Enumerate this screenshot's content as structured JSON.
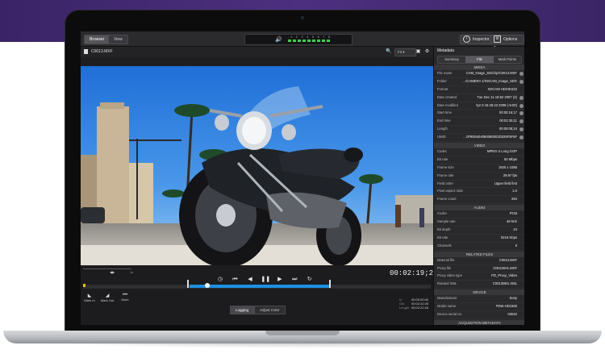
{
  "topbar": {
    "tabs": [
      "Browser",
      "View"
    ],
    "meter_scale": "-1 2 3 4 5 6 7 8",
    "inspector_label": "Inspector",
    "options_label": "Options"
  },
  "clip": {
    "name": "C0013.MXF",
    "fit_label": "Fit"
  },
  "transport": {
    "speed_a": "◀▶",
    "speed_b": "1x",
    "timecode": "00:02:19;20",
    "mark_in": "Mark In",
    "mark_out": "Mark Out",
    "more": "More",
    "tabs": [
      "Logging",
      "Adjust Color"
    ],
    "in_label": "In",
    "in_value": "00:00:00:00",
    "out_label": "Out",
    "out_value": "00:02:22:26",
    "length_label": "Length",
    "length_value": "00:02:22:26"
  },
  "metadata": {
    "title": "Metadata",
    "tabs": [
      "Summary",
      "File",
      "Mark Points"
    ],
    "sections": [
      {
        "title": "MEDIA",
        "rows": [
          {
            "k": "File name",
            "v": "CAM_Image_SD/Clip/C0013.MXF",
            "info": true
          },
          {
            "k": "Folder",
            "v": "…/CAMERA 1/XDCAM_Image_SD/Clip",
            "info": true
          },
          {
            "k": "Format",
            "v": "XDCAM HD/HD422",
            "info": false
          },
          {
            "k": "Date created",
            "v": "Tue Dec 11 16:52 2007 (2)",
            "info": true
          },
          {
            "k": "Date modified",
            "v": "Apr 9 15:46:22 2008 (-5:00)",
            "info": true
          },
          {
            "k": "Start time",
            "v": "00:00:16;17",
            "info": true
          },
          {
            "k": "End time",
            "v": "00:02:25;11",
            "info": true
          },
          {
            "k": "Length",
            "v": "00:00:08;24",
            "info": true
          },
          {
            "k": "UMID",
            "v": "…0F9D6404050080002D025F5F5F",
            "info": true
          }
        ]
      },
      {
        "title": "VIDEO",
        "rows": [
          {
            "k": "Codec",
            "v": "MPEG-2 Long GOP",
            "info": false
          },
          {
            "k": "Bit rate",
            "v": "50 Mbps",
            "info": false
          },
          {
            "k": "Frame size",
            "v": "1920 x 1080",
            "info": false
          },
          {
            "k": "Frame rate",
            "v": "29.97 fps",
            "info": false
          },
          {
            "k": "Field order",
            "v": "Upper field first",
            "info": false
          },
          {
            "k": "Pixel aspect ratio",
            "v": "1.0",
            "info": false
          },
          {
            "k": "Frame count",
            "v": "264",
            "info": false
          }
        ]
      },
      {
        "title": "AUDIO",
        "rows": [
          {
            "k": "Codec",
            "v": "PCM",
            "info": false
          },
          {
            "k": "Sample rate",
            "v": "48 kHz",
            "info": false
          },
          {
            "k": "Bit depth",
            "v": "24",
            "info": false
          },
          {
            "k": "Bit rate",
            "v": "9216 Kbps",
            "info": false
          },
          {
            "k": "Channels",
            "v": "8",
            "info": false
          }
        ]
      },
      {
        "title": "RELATED FILES",
        "rows": [
          {
            "k": "Material file",
            "v": "C0013.MXF",
            "info": false
          },
          {
            "k": "Proxy file",
            "v": "C0013S01.MXF",
            "info": false
          },
          {
            "k": "Proxy video type",
            "v": "PD_Proxy_Video",
            "info": false
          },
          {
            "k": "Related XML",
            "v": "C0013M01.XML",
            "info": false
          }
        ]
      },
      {
        "title": "DEVICE",
        "rows": [
          {
            "k": "Manufacturer",
            "v": "Sony",
            "info": false
          },
          {
            "k": "Model name",
            "v": "PDW-HD1500",
            "info": false
          },
          {
            "k": "Device serial no.",
            "v": "03042",
            "info": false
          }
        ]
      },
      {
        "title": "ACQUISITION METADATA",
        "rows": [
          {
            "k": "Cache rec.",
            "v": "No",
            "info": false
          }
        ]
      }
    ]
  }
}
